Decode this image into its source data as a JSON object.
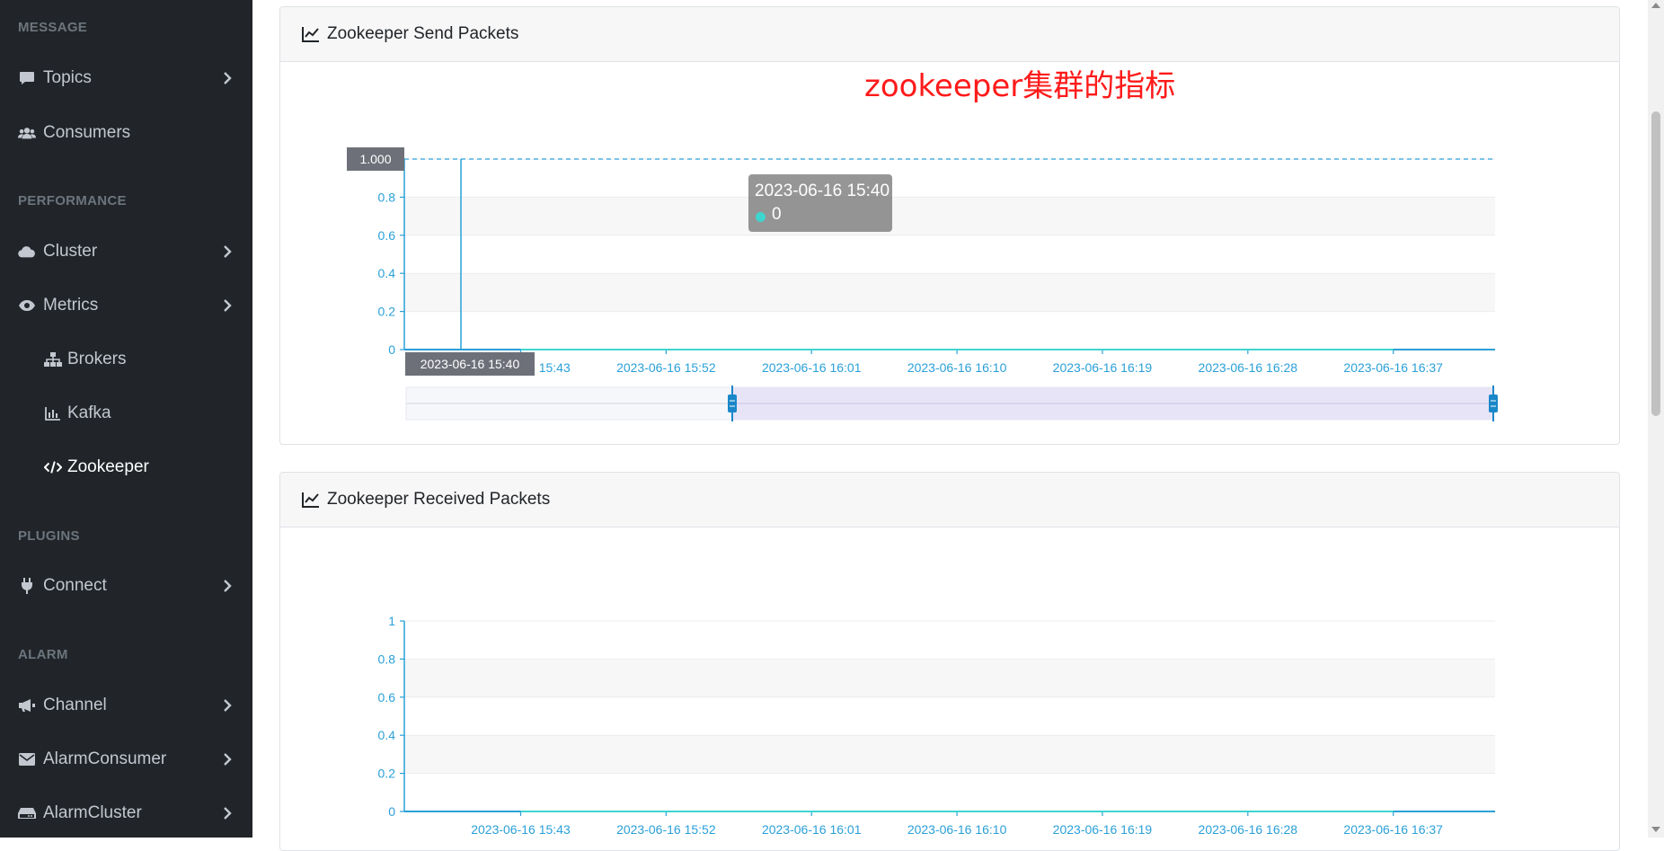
{
  "sidebar": {
    "sections": {
      "message": "MESSAGE",
      "performance": "PERFORMANCE",
      "plugins": "PLUGINS",
      "alarm": "ALARM"
    },
    "items": {
      "topics": "Topics",
      "consumers": "Consumers",
      "cluster": "Cluster",
      "metrics": "Metrics",
      "brokers": "Brokers",
      "kafka": "Kafka",
      "zookeeper": "Zookeeper",
      "connect": "Connect",
      "channel": "Channel",
      "alarm_consumer": "AlarmConsumer",
      "alarm_cluster": "AlarmCluster"
    },
    "active": "zookeeper"
  },
  "annotation": "zookeeper集群的指标",
  "colors": {
    "axis": "#2aa0d8",
    "sidebar_bg": "#212529",
    "annotation": "#ff1a1a",
    "series": "#3fd5cf"
  },
  "charts": {
    "send": {
      "title": "Zookeeper Send Packets",
      "tooltip": {
        "date": "2023-06-16 15:40",
        "value": "0"
      },
      "axis_pointer_y": "1.000",
      "axis_pointer_x": "2023-06-16 15:40"
    },
    "received": {
      "title": "Zookeeper Received Packets"
    }
  },
  "chart_data": [
    {
      "type": "line",
      "title": "Zookeeper Send Packets",
      "x": [
        "2023-06-16 15:43",
        "2023-06-16 15:52",
        "2023-06-16 16:01",
        "2023-06-16 16:10",
        "2023-06-16 16:19",
        "2023-06-16 16:28",
        "2023-06-16 16:37"
      ],
      "y_ticks": [
        "0",
        "0.2",
        "0.4",
        "0.6",
        "0.8"
      ],
      "ylim": [
        0,
        1
      ],
      "series": [
        {
          "values": [
            0,
            0,
            0,
            0,
            0,
            0,
            0
          ]
        }
      ],
      "grid": true,
      "data_zoom": {
        "start": 0.3,
        "end": 1.0
      }
    },
    {
      "type": "line",
      "title": "Zookeeper Received Packets",
      "x": [
        "2023-06-16 15:43",
        "2023-06-16 15:52",
        "2023-06-16 16:01",
        "2023-06-16 16:10",
        "2023-06-16 16:19",
        "2023-06-16 16:28",
        "2023-06-16 16:37"
      ],
      "y_ticks": [
        "0",
        "0.2",
        "0.4",
        "0.6",
        "0.8",
        "1"
      ],
      "ylim": [
        0,
        1
      ],
      "series": [
        {
          "values": [
            0,
            0,
            0,
            0,
            0,
            0,
            0
          ]
        }
      ],
      "grid": true
    }
  ]
}
